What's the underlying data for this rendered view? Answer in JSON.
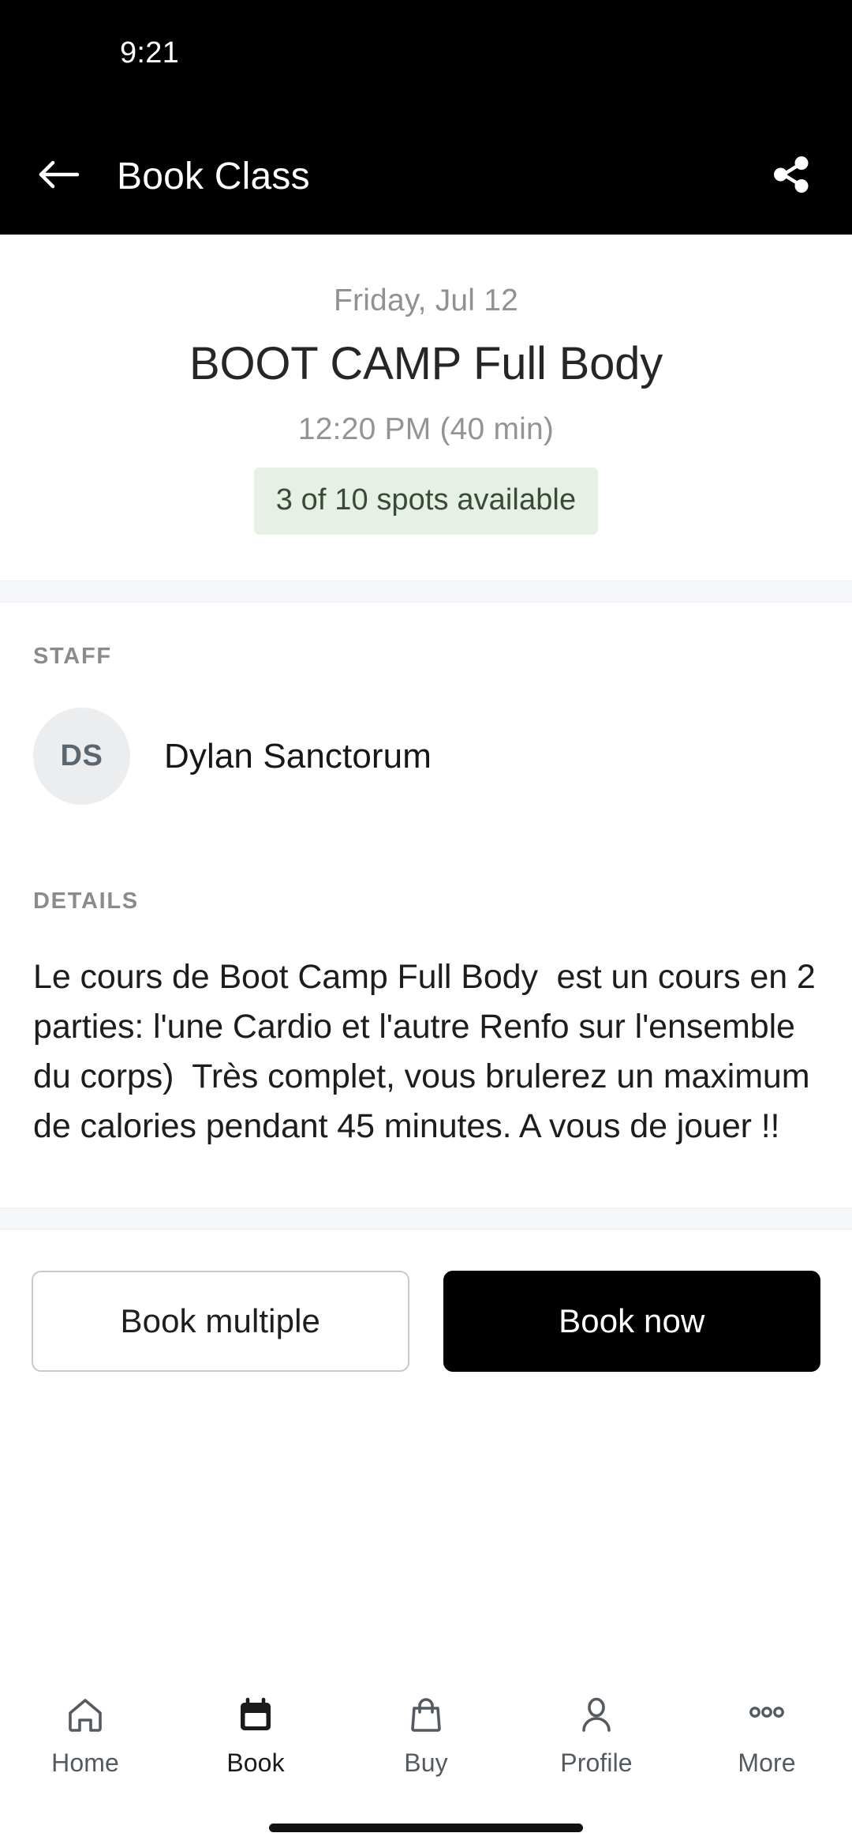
{
  "status_bar": {
    "time": "9:21"
  },
  "app_bar": {
    "title": "Book Class",
    "back_icon": "arrow-left-icon",
    "share_icon": "share-icon"
  },
  "class": {
    "date": "Friday, Jul 12",
    "name": "BOOT CAMP Full Body",
    "time": "12:20 PM (40 min)",
    "spots": "3 of 10 spots available",
    "spots_bg_color": "#e6f0e4",
    "spots_text_color": "#394b38"
  },
  "staff": {
    "label": "STAFF",
    "avatar_initials": "DS",
    "name": "Dylan Sanctorum"
  },
  "details": {
    "label": "DETAILS",
    "text": "Le cours de Boot Camp Full Body  est un cours en 2 parties: l'une Cardio et l'autre Renfo sur l'ensemble du corps)  Très complet, vous brulerez un maximum de calories pendant 45 minutes. A vous de jouer !!"
  },
  "actions": {
    "book_multiple_label": "Book multiple",
    "book_now_label": "Book now"
  },
  "bottom_nav": {
    "items": [
      {
        "label": "Home",
        "icon": "home-icon",
        "active": false
      },
      {
        "label": "Book",
        "icon": "calendar-icon",
        "active": true
      },
      {
        "label": "Buy",
        "icon": "shopping-bag-icon",
        "active": false
      },
      {
        "label": "Profile",
        "icon": "person-icon",
        "active": false
      },
      {
        "label": "More",
        "icon": "ellipsis-icon",
        "active": false
      }
    ]
  }
}
